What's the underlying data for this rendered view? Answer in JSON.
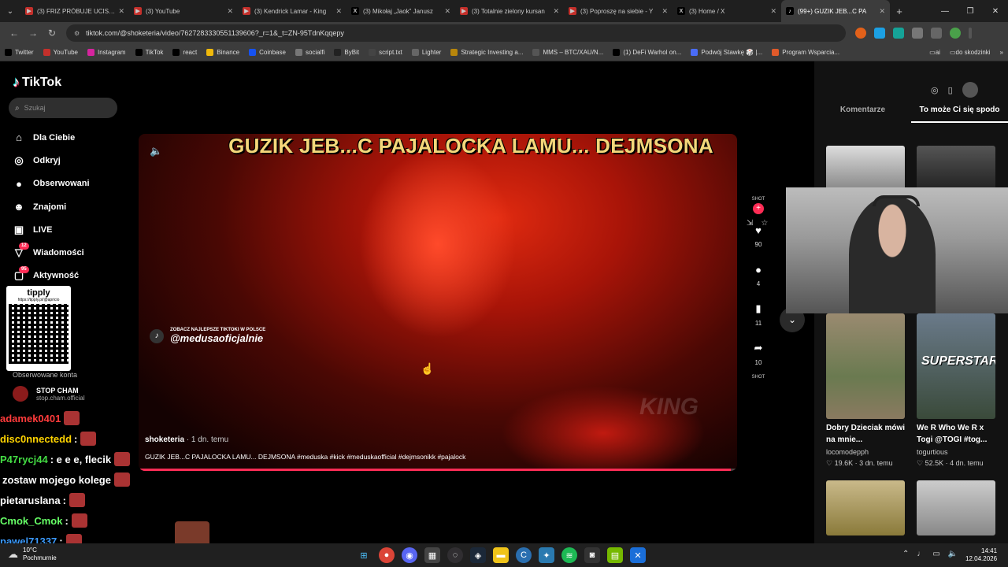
{
  "browser": {
    "tabs": [
      {
        "title": "(3) FRIZ PRÓBUJE UCISZYĆ",
        "fav_color": "#c4302b",
        "fav_glyph": "▶"
      },
      {
        "title": "(3) YouTube",
        "fav_color": "#c4302b",
        "fav_glyph": "▶"
      },
      {
        "title": "(3) Kendrick Lamar - King",
        "fav_color": "#c4302b",
        "fav_glyph": "▶"
      },
      {
        "title": "(3) Mikołaj „Jaok” Janusz",
        "fav_color": "#000000",
        "fav_glyph": "X"
      },
      {
        "title": "(3) Totalnie zielony kursan",
        "fav_color": "#c4302b",
        "fav_glyph": "▶"
      },
      {
        "title": "(3) Poproszę na siebie - Y",
        "fav_color": "#c4302b",
        "fav_glyph": "▶"
      },
      {
        "title": "(3) Home / X",
        "fav_color": "#000000",
        "fav_glyph": "X"
      },
      {
        "title": "(99+) GUZIK JEB...C PA",
        "fav_color": "#000000",
        "fav_glyph": "♪"
      }
    ],
    "url": "tiktok.com/@shoketeria/video/7627283330551139606?_r=1&_t=ZN-95TdnKqqepy",
    "bookmarks": [
      {
        "label": "Twitter",
        "color": "#000000"
      },
      {
        "label": "YouTube",
        "color": "#c4302b"
      },
      {
        "label": "Instagram",
        "color": "#d6249f"
      },
      {
        "label": "TikTok",
        "color": "#000000"
      },
      {
        "label": "react",
        "color": "#000000"
      },
      {
        "label": "Binance",
        "color": "#f0b90b"
      },
      {
        "label": "Coinbase",
        "color": "#1652f0"
      },
      {
        "label": "socialfi",
        "color": "#777777"
      },
      {
        "label": "ByBit",
        "color": "#222222"
      },
      {
        "label": "script.txt",
        "color": "#444444"
      },
      {
        "label": "Lighter",
        "color": "#666666"
      },
      {
        "label": "Strategic Investing a...",
        "color": "#b8860b"
      },
      {
        "label": "MMS – BTC/XAU/N...",
        "color": "#555555"
      },
      {
        "label": "(1) DeFi Warhol on...",
        "color": "#000000"
      },
      {
        "label": "Podwój Stawkę 🎲 |...",
        "color": "#4a6cf7"
      },
      {
        "label": "Program Wsparcia...",
        "color": "#e05a2a"
      }
    ],
    "bookmarks_right": [
      {
        "label": "ai"
      },
      {
        "label": "do skodzinki"
      }
    ]
  },
  "tiktok": {
    "logo": "TikTok",
    "search_placeholder": "Szukaj",
    "nav": [
      {
        "label": "Dla Ciebie",
        "icon": "⌂",
        "badge": ""
      },
      {
        "label": "Odkryj",
        "icon": "◎",
        "badge": ""
      },
      {
        "label": "Obserwowani",
        "icon": "●",
        "badge": ""
      },
      {
        "label": "Znajomi",
        "icon": "☻",
        "badge": ""
      },
      {
        "label": "LIVE",
        "icon": "▣",
        "badge": ""
      },
      {
        "label": "Wiadomości",
        "icon": "▽",
        "badge": "12"
      },
      {
        "label": "Aktywność",
        "icon": "▢",
        "badge": "95"
      }
    ],
    "qr_title": "tipply",
    "qr_sub": "https://tipply.pl/@apricio",
    "followed_label": "Obserwowane konta",
    "followed_account": {
      "name": "STOP CHAM",
      "handle": "stop.cham.official"
    },
    "video": {
      "title_overlay": "GUZIK JEB...C PAJALOCKA LAMU... DEJMSONA",
      "watermark_top": "ZOBACZ NAJLEPSZE TIKTOKI W POLSCE",
      "watermark_handle": "@medusaoficjalnie",
      "author": "shoketeria",
      "posted": "· 1 dn. temu",
      "caption": "GUZIK JEB...C PAJALOCKA LAMU... DEJMSONA #meduska #kick #meduskaofficial #dejmsonikk #pajalock",
      "progress": 0.99,
      "kick_tag": "KING"
    },
    "actions": {
      "shot_top": "SHOT",
      "likes": "90",
      "comments": "4",
      "saves": "11",
      "shares": "10",
      "shot_bottom": "SHOT"
    },
    "right_tabs": [
      "Komentarze",
      "To może Ci się spodo"
    ],
    "suggestions": [
      {
        "title": "Dobry Dzieciak mówi na mnie...",
        "author": "locomodepph",
        "meta": "♡ 19.6K · 3 dn. temu"
      },
      {
        "title": "We R Who We R x Togi @TOGI #tog...",
        "author": "togurtious",
        "meta": "♡ 52.5K · 4 dn. temu",
        "thumb_text": "SUPERSTARS"
      }
    ]
  },
  "chat": [
    {
      "user": "adamek0401",
      "text": "",
      "color": "#ff3b3b"
    },
    {
      "user": "disc0nnectedd",
      "text": ":",
      "color": "#ffd400"
    },
    {
      "user": "P47rycj44",
      "text": ": e e e, flecik",
      "color": "#44dd44"
    },
    {
      "user": "",
      "text": "zostaw mojego kolege",
      "color": "#ffffff"
    },
    {
      "user": "pietaruslana",
      "text": ":",
      "color": "#ffffff"
    },
    {
      "user": "Cmok_Cmok",
      "text": ":",
      "color": "#66ff66"
    },
    {
      "user": "pawel71337",
      "text": ":",
      "color": "#3b9bff"
    }
  ],
  "emote_text": "x6",
  "taskbar": {
    "temp": "10°C",
    "weather": "Pochmurnie",
    "time": "14:41",
    "date": "12.04.2026"
  }
}
